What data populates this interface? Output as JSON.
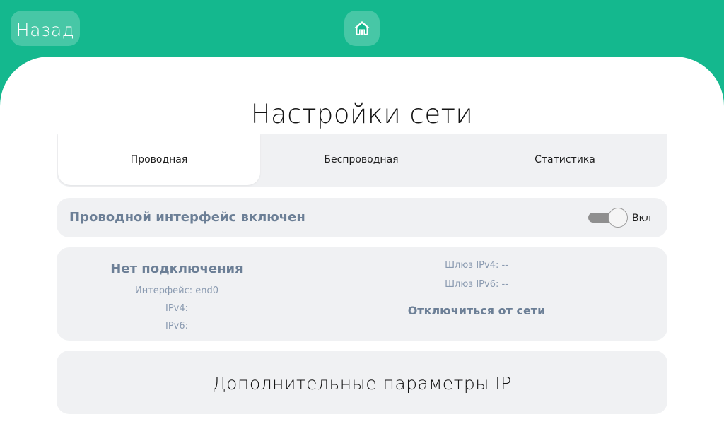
{
  "header": {
    "back_label": "Назад",
    "home_icon": "home-icon"
  },
  "page": {
    "title": "Настройки сети"
  },
  "tabs": [
    {
      "label": "Проводная",
      "active": true
    },
    {
      "label": "Беспроводная",
      "active": false
    },
    {
      "label": "Статистика",
      "active": false
    }
  ],
  "wired": {
    "toggle_label": "Проводной интерфейс включен",
    "toggle_state": "Вкл",
    "enabled": true
  },
  "status": {
    "title": "Нет подключения",
    "interface": "Интерфейс: end0",
    "ipv4": "IPv4:",
    "ipv6": "IPv6:",
    "gateway_ipv4": "Шлюз IPv4: --",
    "gateway_ipv6": "Шлюз IPv6: --",
    "disconnect_label": "Отключиться от сети"
  },
  "extra": {
    "title": "Дополнительные параметры IP"
  },
  "colors": {
    "accent": "#14b88e",
    "card_bg": "#f0f1f3",
    "muted_text": "#6c7f96"
  }
}
